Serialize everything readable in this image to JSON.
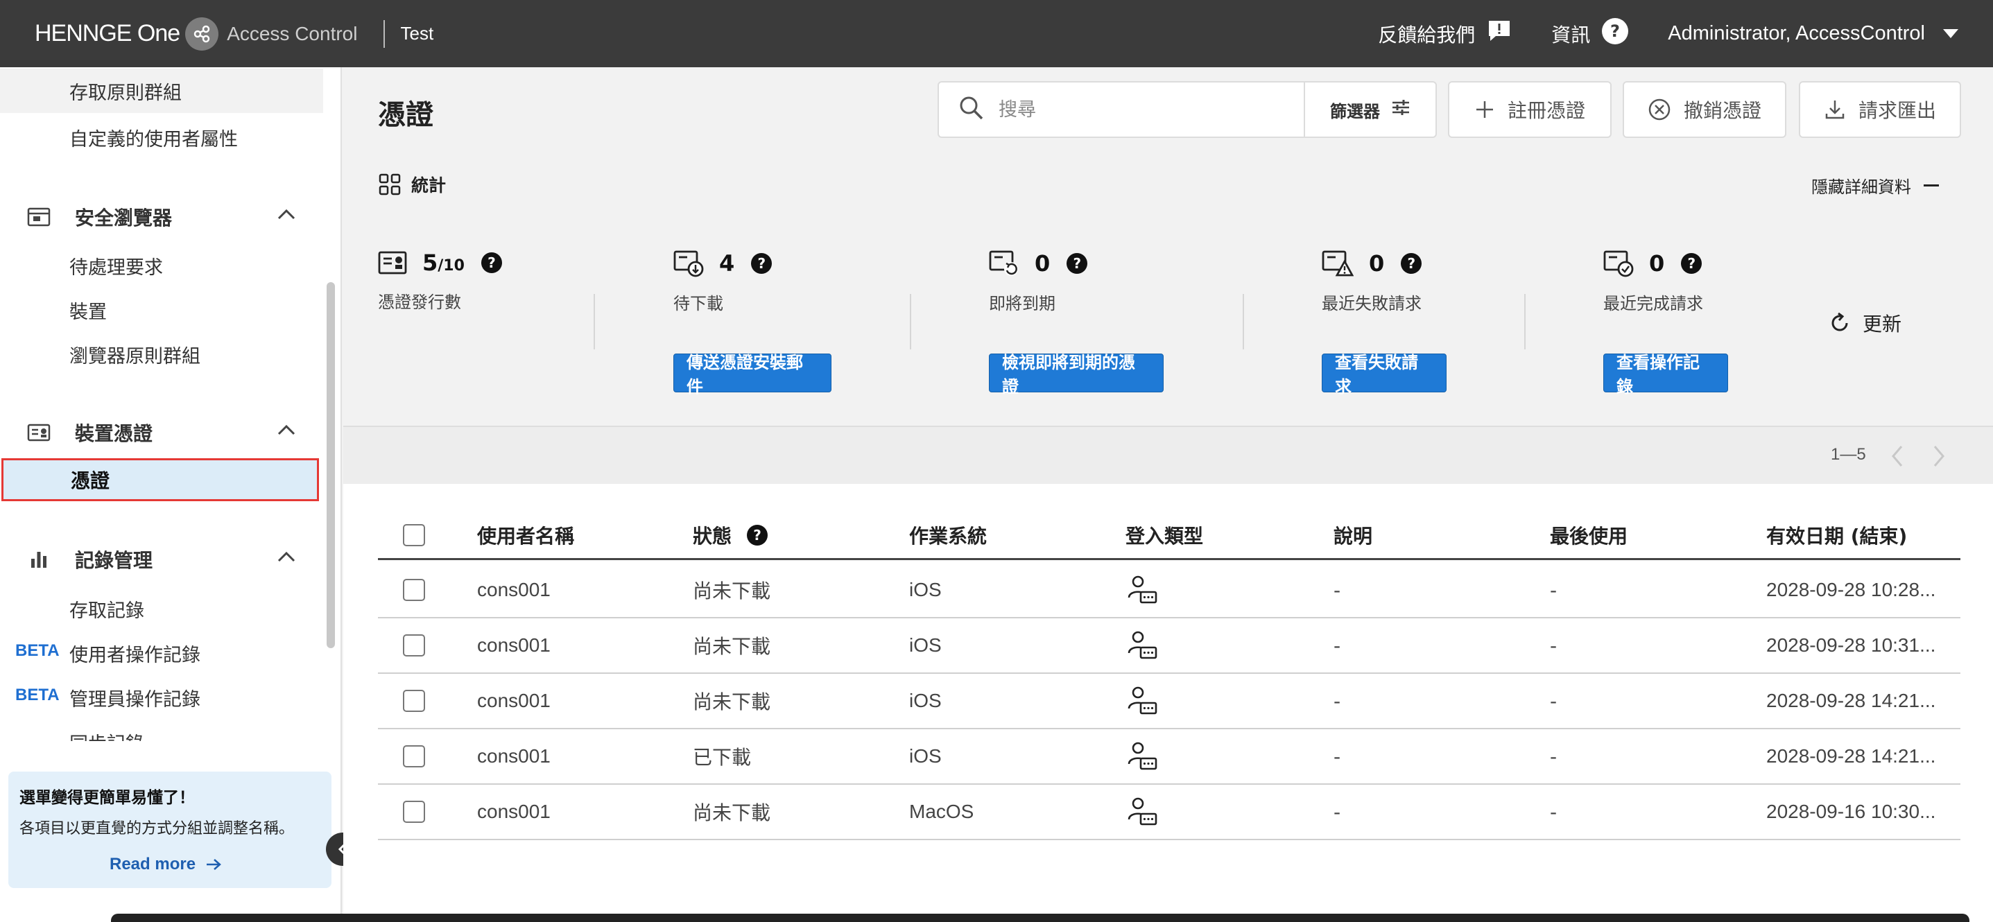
{
  "header": {
    "brand": "HENNGE One",
    "product": "Access Control",
    "tenant": "Test",
    "feedback": "反饋給我們",
    "info": "資訊",
    "user": "Administrator, AccessControl"
  },
  "sidebar": {
    "top_items": [
      "存取原則群組",
      "自定義的使用者屬性"
    ],
    "groups": [
      {
        "label": "安全瀏覽器",
        "items": [
          "待處理要求",
          "裝置",
          "瀏覽器原則群組"
        ]
      },
      {
        "label": "裝置憑證",
        "items": [
          "憑證"
        ]
      },
      {
        "label": "記錄管理",
        "items": [
          "存取記錄",
          "使用者操作記錄",
          "管理員操作記錄",
          "同步記錄"
        ]
      }
    ],
    "active_item": "憑證",
    "beta_label": "BETA",
    "promo": {
      "title": "選單變得更簡單易懂了！",
      "body": "各項目以更直覺的方式分組並調整名稱。",
      "link": "Read more"
    }
  },
  "main": {
    "title": "憑證",
    "search_placeholder": "搜尋",
    "filter_label": "篩選器",
    "buttons": {
      "register": "註冊憑證",
      "revoke": "撤銷憑證",
      "export": "請求匯出"
    },
    "stats_title": "統計",
    "hide_details": "隱藏詳細資料",
    "refresh": "更新",
    "stats": [
      {
        "value": "5",
        "total": "/10",
        "label": "憑證發行數",
        "button": ""
      },
      {
        "value": "4",
        "total": "",
        "label": "待下載",
        "button": "傳送憑證安裝郵件"
      },
      {
        "value": "0",
        "total": "",
        "label": "即將到期",
        "button": "檢視即將到期的憑證"
      },
      {
        "value": "0",
        "total": "",
        "label": "最近失敗請求",
        "button": "查看失敗請求"
      },
      {
        "value": "0",
        "total": "",
        "label": "最近完成請求",
        "button": "查看操作記錄"
      }
    ],
    "pager": "1—5"
  },
  "table": {
    "columns": [
      "使用者名稱",
      "狀態",
      "作業系統",
      "登入類型",
      "說明",
      "最後使用",
      "有效日期 (結束)"
    ],
    "rows": [
      {
        "user": "cons001",
        "status": "尚未下載",
        "os": "iOS",
        "login_icon": "user-card-icon",
        "desc": "-",
        "last_used": "-",
        "expiry": "2028-09-28 10:28..."
      },
      {
        "user": "cons001",
        "status": "尚未下載",
        "os": "iOS",
        "login_icon": "user-card-icon",
        "desc": "-",
        "last_used": "-",
        "expiry": "2028-09-28 10:31..."
      },
      {
        "user": "cons001",
        "status": "尚未下載",
        "os": "iOS",
        "login_icon": "user-card-icon",
        "desc": "-",
        "last_used": "-",
        "expiry": "2028-09-28 14:21..."
      },
      {
        "user": "cons001",
        "status": "已下載",
        "os": "iOS",
        "login_icon": "user-card-icon",
        "desc": "-",
        "last_used": "-",
        "expiry": "2028-09-28 14:21..."
      },
      {
        "user": "cons001",
        "status": "尚未下載",
        "os": "MacOS",
        "login_icon": "user-card-icon",
        "desc": "-",
        "last_used": "-",
        "expiry": "2028-09-16 10:30..."
      }
    ]
  },
  "colors": {
    "header_bg": "#3b3b3b",
    "accent": "#1f7ad6",
    "active_bg": "#dcecf8",
    "highlight_border": "#e53935",
    "beta": "#1f6fd1"
  }
}
